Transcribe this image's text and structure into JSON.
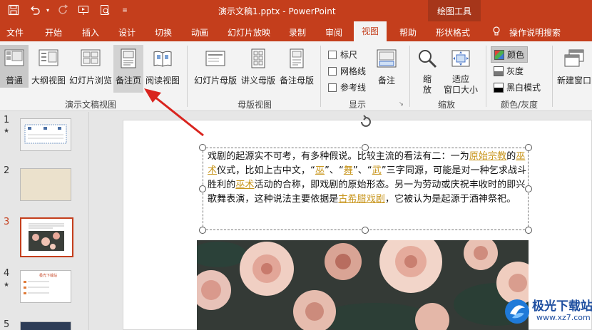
{
  "app": {
    "document_title": "演示文稿1.pptx - PowerPoint",
    "contextual_group": "绘图工具"
  },
  "tabs": [
    "文件",
    "开始",
    "插入",
    "设计",
    "切换",
    "动画",
    "幻灯片放映",
    "录制",
    "审阅",
    "视图",
    "帮助",
    "形状格式"
  ],
  "active_tab": "视图",
  "tell_me": "操作说明搜索",
  "ribbon": {
    "presentation_views": {
      "label": "演示文稿视图",
      "buttons": [
        "普通",
        "大纲视图",
        "幻灯片浏览",
        "备注页",
        "阅读视图"
      ],
      "selected": "普通",
      "highlighted": "备注页"
    },
    "master_views": {
      "label": "母版视图",
      "buttons": [
        "幻灯片母版",
        "讲义母版",
        "备注母版"
      ]
    },
    "show": {
      "label": "显示",
      "checkboxes": [
        "标尺",
        "网格线",
        "参考线"
      ],
      "notes_button": "备注"
    },
    "zoom": {
      "label": "缩放",
      "zoom_button": "缩放",
      "fit_button": "适应\n窗口大小"
    },
    "color": {
      "label": "颜色/灰度",
      "options": [
        "颜色",
        "灰度",
        "黑白模式"
      ],
      "selected": "颜色"
    },
    "window": {
      "new_window": "新建窗口"
    }
  },
  "slides": [
    {
      "number": "1",
      "star": true
    },
    {
      "number": "2",
      "star": false
    },
    {
      "number": "3",
      "star": false,
      "current": true
    },
    {
      "number": "4",
      "star": true
    },
    {
      "number": "5",
      "star": false
    }
  ],
  "slide4_thumb_title": "极光下载站",
  "notes_text": {
    "p1": "戏剧的起源实不可考，有多种假说。比较主流的看法有二：一为",
    "link1": "原始宗教",
    "p2": "的",
    "link2": "巫术",
    "p3": "仪式，比如上古中文，“",
    "link3": "巫",
    "p4": "”、“",
    "link4": "舞",
    "p5": "”、“",
    "link5": "武",
    "p6": "”三字同源，可能是对一种乞求战斗胜利的",
    "link6": "巫术",
    "p7": "活动的合称，即戏剧的原始形态。另一为劳动或庆祝丰收时的即兴歌舞表演，这种说法主要依据是",
    "link7": "古希腊戏剧",
    "p8": "，它被认为是起源于酒神祭祀。"
  },
  "watermark": {
    "name": "极光下载站",
    "url": "www.xz7.com"
  },
  "colors": {
    "accent": "#c43e1c",
    "link": "#c8961e",
    "arrow": "#d9241e"
  }
}
